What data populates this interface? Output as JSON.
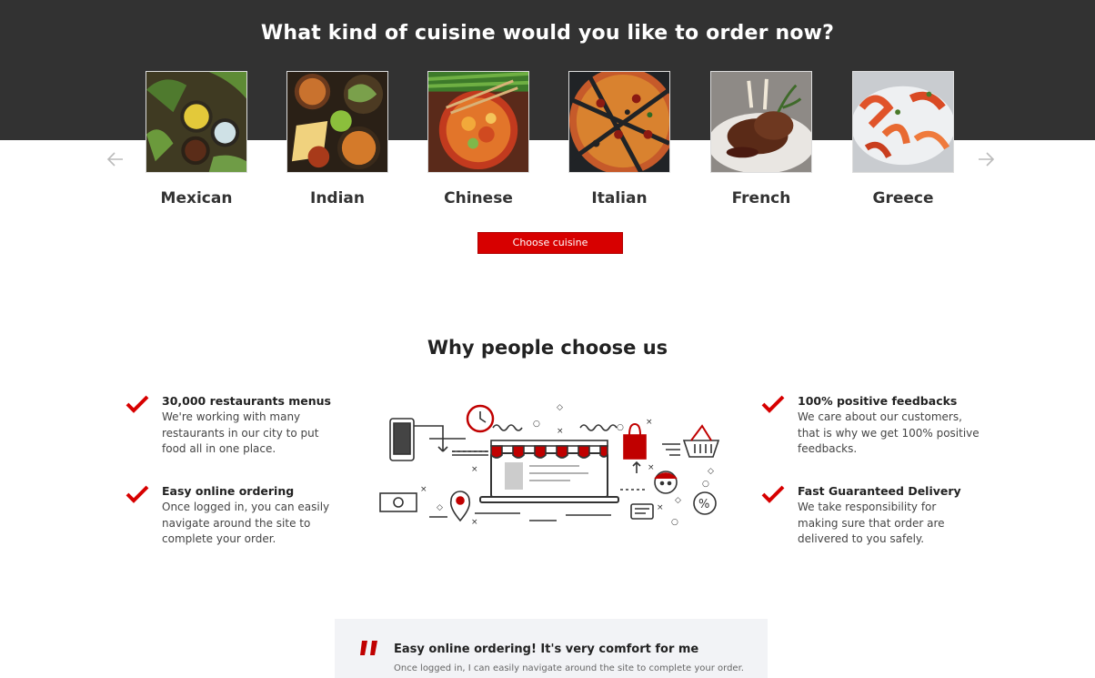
{
  "hero": {
    "title": "What kind of cuisine would you like to order now?",
    "background": "#323232"
  },
  "carousel": {
    "prev_icon": "arrow-left-icon",
    "next_icon": "arrow-right-icon",
    "items": [
      {
        "label": "Mexican",
        "image": "mexican-food-photo"
      },
      {
        "label": "Indian",
        "image": "indian-food-photo"
      },
      {
        "label": "Chinese",
        "image": "chinese-food-photo"
      },
      {
        "label": "Italian",
        "image": "pizza-photo"
      },
      {
        "label": "French",
        "image": "french-lamb-photo"
      },
      {
        "label": "Greece",
        "image": "greek-seafood-photo"
      }
    ]
  },
  "cta": {
    "label": "Choose cuisine",
    "color": "#d70000"
  },
  "why": {
    "title": "Why people choose us",
    "check_icon": "red-check-icon",
    "features": [
      {
        "title": "30,000 restaurants menus",
        "desc": "We're working with many restaurants in our city to put food all in one place."
      },
      {
        "title": "Easy online ordering",
        "desc": "Once logged in, you can easily navigate around the site to complete your order."
      },
      {
        "title": "100% positive feedbacks",
        "desc": "We care about our customers, that is why we get 100% positive feedbacks."
      },
      {
        "title": "Fast Guaranteed Delivery",
        "desc": "We take responsibility for making sure that order are delivered to you safely."
      }
    ],
    "illustration": "online-shop-illustration"
  },
  "testimonial": {
    "quote_icon": "quote-icon",
    "title": "Easy online ordering! It's very comfort for me",
    "desc": "Once logged in, I can easily navigate around the site to complete your order."
  },
  "colors": {
    "accent": "#d70000",
    "dark": "#323232"
  }
}
